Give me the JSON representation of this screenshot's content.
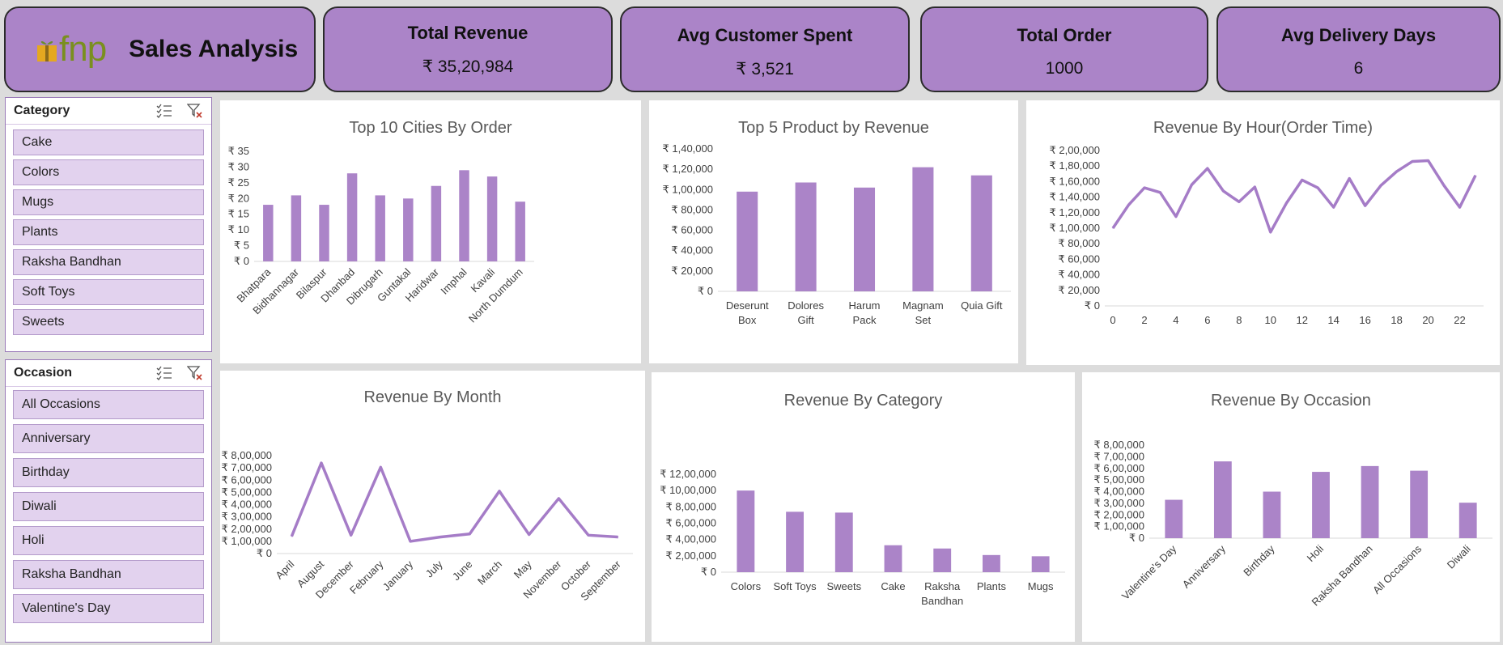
{
  "header": {
    "logo_text": "fnp",
    "title": "Sales Analysis"
  },
  "kpis": [
    {
      "title": "Total Revenue",
      "value": "₹ 35,20,984"
    },
    {
      "title": "Avg Customer Spent",
      "value": "₹ 3,521"
    },
    {
      "title": "Total Order",
      "value": "1000"
    },
    {
      "title": "Avg Delivery Days",
      "value": "6"
    }
  ],
  "slicers": {
    "category": {
      "title": "Category",
      "items": [
        "Cake",
        "Colors",
        "Mugs",
        "Plants",
        "Raksha Bandhan",
        "Soft Toys",
        "Sweets"
      ]
    },
    "occasion": {
      "title": "Occasion",
      "items": [
        "All Occasions",
        "Anniversary",
        "Birthday",
        "Diwali",
        "Holi",
        "Raksha Bandhan",
        "Valentine's Day"
      ]
    }
  },
  "colors": {
    "accent": "#ab84c8",
    "bar": "#ab84c8",
    "line": "#a57cc7"
  },
  "chart_data": [
    {
      "id": "cities",
      "type": "bar",
      "title": "Top 10 Cities By Order",
      "categories": [
        "Bhatpara",
        "Bidhannagar",
        "Bilaspur",
        "Dhanbad",
        "Dibrugarh",
        "Guntakal",
        "Haridwar",
        "Imphal",
        "Kavali",
        "North Dumdum"
      ],
      "values": [
        18,
        21,
        18,
        28,
        21,
        20,
        24,
        29,
        27,
        19
      ],
      "ylim": [
        0,
        35
      ],
      "yticks": [
        "₹ 0",
        "₹ 5",
        "₹ 10",
        "₹ 15",
        "₹ 20",
        "₹ 25",
        "₹ 30",
        "₹ 35"
      ]
    },
    {
      "id": "products",
      "type": "bar",
      "title": "Top 5 Product by Revenue",
      "categories": [
        [
          "Deserunt",
          "Box"
        ],
        [
          "Dolores",
          "Gift"
        ],
        [
          "Harum",
          "Pack"
        ],
        [
          "Magnam",
          "Set"
        ],
        [
          "Quia Gift"
        ]
      ],
      "values": [
        98000,
        107000,
        102000,
        122000,
        114000
      ],
      "ylim": [
        0,
        140000
      ],
      "yticks": [
        "₹ 0",
        "₹ 20,000",
        "₹ 40,000",
        "₹ 60,000",
        "₹ 80,000",
        "₹ 1,00,000",
        "₹ 1,20,000",
        "₹ 1,40,000"
      ]
    },
    {
      "id": "hour",
      "type": "line",
      "title": "Revenue By Hour(Order Time)",
      "x": [
        0,
        1,
        2,
        3,
        4,
        5,
        6,
        7,
        8,
        9,
        10,
        11,
        12,
        13,
        14,
        15,
        16,
        17,
        18,
        19,
        20,
        21,
        22,
        23
      ],
      "xticks": [
        "0",
        "2",
        "4",
        "6",
        "8",
        "10",
        "12",
        "14",
        "16",
        "18",
        "20",
        "22"
      ],
      "values": [
        100000,
        130000,
        152000,
        146000,
        115000,
        156000,
        177000,
        148000,
        134000,
        153000,
        95000,
        132000,
        162000,
        152000,
        127000,
        164000,
        129000,
        155000,
        173000,
        186000,
        187000,
        155000,
        127000,
        168000
      ],
      "ylim": [
        0,
        200000
      ],
      "yticks": [
        "₹ 0",
        "₹ 20,000",
        "₹ 40,000",
        "₹ 60,000",
        "₹ 80,000",
        "₹ 1,00,000",
        "₹ 1,20,000",
        "₹ 1,40,000",
        "₹ 1,60,000",
        "₹ 1,80,000",
        "₹ 2,00,000"
      ]
    },
    {
      "id": "month",
      "type": "line",
      "title": "Revenue By Month",
      "categories": [
        "April",
        "August",
        "December",
        "February",
        "January",
        "July",
        "June",
        "March",
        "May",
        "November",
        "October",
        "September"
      ],
      "values": [
        140000,
        740000,
        150000,
        705000,
        100000,
        135000,
        160000,
        510000,
        155000,
        450000,
        150000,
        135000
      ],
      "ylim": [
        0,
        800000
      ],
      "yticks": [
        "₹ 0",
        "₹ 1,00,000",
        "₹ 2,00,000",
        "₹ 3,00,000",
        "₹ 4,00,000",
        "₹ 5,00,000",
        "₹ 6,00,000",
        "₹ 7,00,000",
        "₹ 8,00,000"
      ]
    },
    {
      "id": "category",
      "type": "bar",
      "title": "Revenue By Category",
      "categories": [
        [
          "Colors"
        ],
        [
          "Soft Toys"
        ],
        [
          "Sweets"
        ],
        [
          "Cake"
        ],
        [
          "Raksha",
          "Bandhan"
        ],
        [
          "Plants"
        ],
        [
          "Mugs"
        ]
      ],
      "values": [
        1000000,
        740000,
        730000,
        330000,
        290000,
        210000,
        195000
      ],
      "ylim": [
        0,
        1200000
      ],
      "yticks": [
        "₹ 0",
        "₹ 2,00,000",
        "₹ 4,00,000",
        "₹ 6,00,000",
        "₹ 8,00,000",
        "₹ 10,00,000",
        "₹ 12,00,000"
      ]
    },
    {
      "id": "occasion",
      "type": "bar",
      "title": "Revenue By Occasion",
      "categories": [
        "Valentine's Day",
        "Anniversary",
        "Birthday",
        "Holi",
        "Raksha Bandhan",
        "All Occasions",
        "Diwali"
      ],
      "values": [
        330000,
        660000,
        400000,
        570000,
        620000,
        580000,
        305000
      ],
      "ylim": [
        0,
        800000
      ],
      "yticks": [
        "₹ 0",
        "₹ 1,00,000",
        "₹ 2,00,000",
        "₹ 3,00,000",
        "₹ 4,00,000",
        "₹ 5,00,000",
        "₹ 6,00,000",
        "₹ 7,00,000",
        "₹ 8,00,000"
      ]
    }
  ]
}
